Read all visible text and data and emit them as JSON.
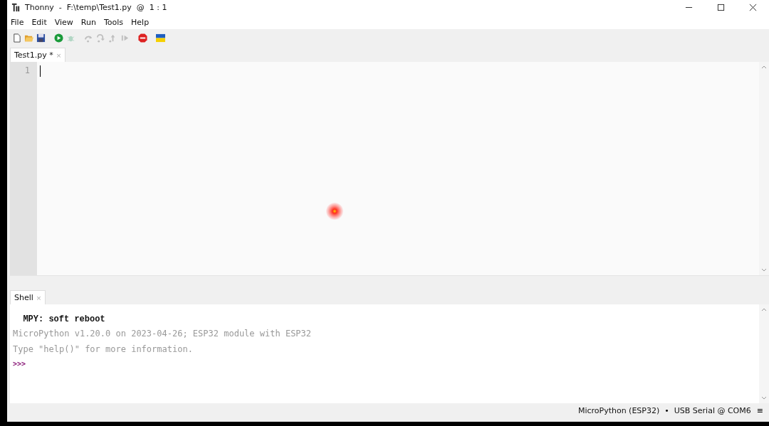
{
  "window": {
    "title": "Thonny  -  F:\\temp\\Test1.py  @  1 : 1"
  },
  "menu": [
    "File",
    "Edit",
    "View",
    "Run",
    "Tools",
    "Help"
  ],
  "toolbar": [
    {
      "kind": "new",
      "disabled": false
    },
    {
      "kind": "open",
      "disabled": false
    },
    {
      "kind": "save",
      "disabled": false
    },
    {
      "kind": "run",
      "disabled": false
    },
    {
      "kind": "debug",
      "disabled": true
    },
    {
      "kind": "step-over",
      "disabled": true
    },
    {
      "kind": "step-into",
      "disabled": true
    },
    {
      "kind": "step-out",
      "disabled": true
    },
    {
      "kind": "resume",
      "disabled": true
    },
    {
      "kind": "stop",
      "disabled": false
    },
    {
      "kind": "flag",
      "disabled": false
    }
  ],
  "editor_tabs": [
    {
      "label": "Test1.py *",
      "close": "×",
      "selected": true
    }
  ],
  "editor": {
    "line_numbers": [
      "1"
    ]
  },
  "shell_tabs": [
    {
      "label": "Shell",
      "close": "×",
      "selected": true
    }
  ],
  "shell": {
    "lines": [
      {
        "kind": "output",
        "text": "  MPY: soft reboot"
      },
      {
        "kind": "banner",
        "text": "MicroPython v1.20.0 on 2023-04-26; ESP32 module with ESP32"
      },
      {
        "kind": "banner",
        "text": "Type \"help()\" for more information."
      },
      {
        "kind": "prompt",
        "text": ">>>"
      }
    ]
  },
  "status_bar": {
    "text": "MicroPython (ESP32)  •  USB Serial @ COM6",
    "menu": "≡"
  }
}
